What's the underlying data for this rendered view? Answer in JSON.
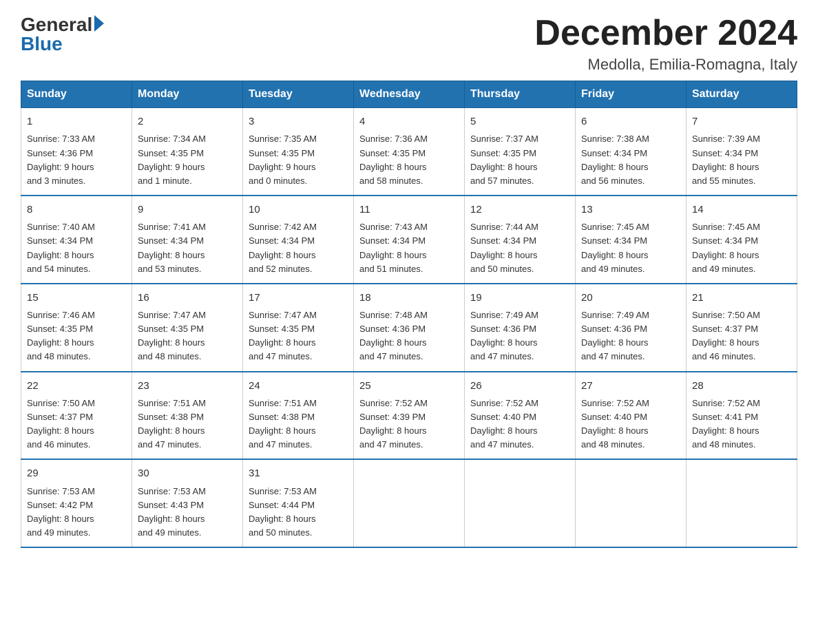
{
  "logo": {
    "general": "General",
    "blue": "Blue"
  },
  "title": {
    "month": "December 2024",
    "location": "Medolla, Emilia-Romagna, Italy"
  },
  "headers": [
    "Sunday",
    "Monday",
    "Tuesday",
    "Wednesday",
    "Thursday",
    "Friday",
    "Saturday"
  ],
  "weeks": [
    [
      {
        "day": "1",
        "sunrise": "7:33 AM",
        "sunset": "4:36 PM",
        "daylight": "9 hours and 3 minutes."
      },
      {
        "day": "2",
        "sunrise": "7:34 AM",
        "sunset": "4:35 PM",
        "daylight": "9 hours and 1 minute."
      },
      {
        "day": "3",
        "sunrise": "7:35 AM",
        "sunset": "4:35 PM",
        "daylight": "9 hours and 0 minutes."
      },
      {
        "day": "4",
        "sunrise": "7:36 AM",
        "sunset": "4:35 PM",
        "daylight": "8 hours and 58 minutes."
      },
      {
        "day": "5",
        "sunrise": "7:37 AM",
        "sunset": "4:35 PM",
        "daylight": "8 hours and 57 minutes."
      },
      {
        "day": "6",
        "sunrise": "7:38 AM",
        "sunset": "4:34 PM",
        "daylight": "8 hours and 56 minutes."
      },
      {
        "day": "7",
        "sunrise": "7:39 AM",
        "sunset": "4:34 PM",
        "daylight": "8 hours and 55 minutes."
      }
    ],
    [
      {
        "day": "8",
        "sunrise": "7:40 AM",
        "sunset": "4:34 PM",
        "daylight": "8 hours and 54 minutes."
      },
      {
        "day": "9",
        "sunrise": "7:41 AM",
        "sunset": "4:34 PM",
        "daylight": "8 hours and 53 minutes."
      },
      {
        "day": "10",
        "sunrise": "7:42 AM",
        "sunset": "4:34 PM",
        "daylight": "8 hours and 52 minutes."
      },
      {
        "day": "11",
        "sunrise": "7:43 AM",
        "sunset": "4:34 PM",
        "daylight": "8 hours and 51 minutes."
      },
      {
        "day": "12",
        "sunrise": "7:44 AM",
        "sunset": "4:34 PM",
        "daylight": "8 hours and 50 minutes."
      },
      {
        "day": "13",
        "sunrise": "7:45 AM",
        "sunset": "4:34 PM",
        "daylight": "8 hours and 49 minutes."
      },
      {
        "day": "14",
        "sunrise": "7:45 AM",
        "sunset": "4:34 PM",
        "daylight": "8 hours and 49 minutes."
      }
    ],
    [
      {
        "day": "15",
        "sunrise": "7:46 AM",
        "sunset": "4:35 PM",
        "daylight": "8 hours and 48 minutes."
      },
      {
        "day": "16",
        "sunrise": "7:47 AM",
        "sunset": "4:35 PM",
        "daylight": "8 hours and 48 minutes."
      },
      {
        "day": "17",
        "sunrise": "7:47 AM",
        "sunset": "4:35 PM",
        "daylight": "8 hours and 47 minutes."
      },
      {
        "day": "18",
        "sunrise": "7:48 AM",
        "sunset": "4:36 PM",
        "daylight": "8 hours and 47 minutes."
      },
      {
        "day": "19",
        "sunrise": "7:49 AM",
        "sunset": "4:36 PM",
        "daylight": "8 hours and 47 minutes."
      },
      {
        "day": "20",
        "sunrise": "7:49 AM",
        "sunset": "4:36 PM",
        "daylight": "8 hours and 47 minutes."
      },
      {
        "day": "21",
        "sunrise": "7:50 AM",
        "sunset": "4:37 PM",
        "daylight": "8 hours and 46 minutes."
      }
    ],
    [
      {
        "day": "22",
        "sunrise": "7:50 AM",
        "sunset": "4:37 PM",
        "daylight": "8 hours and 46 minutes."
      },
      {
        "day": "23",
        "sunrise": "7:51 AM",
        "sunset": "4:38 PM",
        "daylight": "8 hours and 47 minutes."
      },
      {
        "day": "24",
        "sunrise": "7:51 AM",
        "sunset": "4:38 PM",
        "daylight": "8 hours and 47 minutes."
      },
      {
        "day": "25",
        "sunrise": "7:52 AM",
        "sunset": "4:39 PM",
        "daylight": "8 hours and 47 minutes."
      },
      {
        "day": "26",
        "sunrise": "7:52 AM",
        "sunset": "4:40 PM",
        "daylight": "8 hours and 47 minutes."
      },
      {
        "day": "27",
        "sunrise": "7:52 AM",
        "sunset": "4:40 PM",
        "daylight": "8 hours and 48 minutes."
      },
      {
        "day": "28",
        "sunrise": "7:52 AM",
        "sunset": "4:41 PM",
        "daylight": "8 hours and 48 minutes."
      }
    ],
    [
      {
        "day": "29",
        "sunrise": "7:53 AM",
        "sunset": "4:42 PM",
        "daylight": "8 hours and 49 minutes."
      },
      {
        "day": "30",
        "sunrise": "7:53 AM",
        "sunset": "4:43 PM",
        "daylight": "8 hours and 49 minutes."
      },
      {
        "day": "31",
        "sunrise": "7:53 AM",
        "sunset": "4:44 PM",
        "daylight": "8 hours and 50 minutes."
      },
      null,
      null,
      null,
      null
    ]
  ],
  "labels": {
    "sunrise": "Sunrise:",
    "sunset": "Sunset:",
    "daylight": "Daylight:"
  }
}
